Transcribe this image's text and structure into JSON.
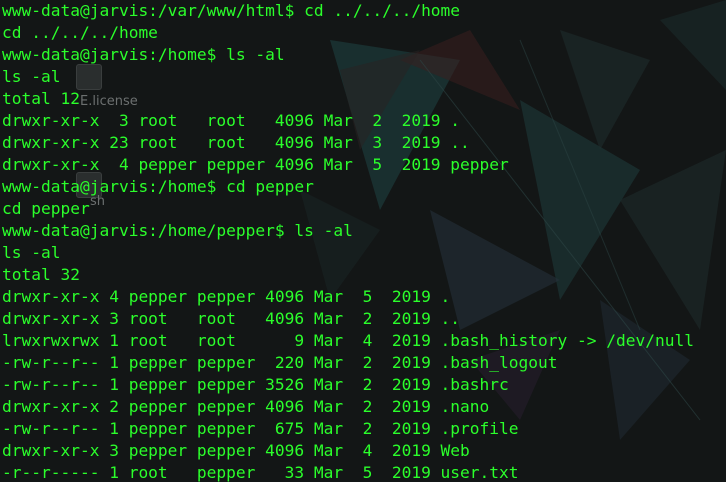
{
  "terminal": {
    "lines": [
      "www-data@jarvis:/var/www/html$ cd ../../../home",
      "cd ../../../home",
      "www-data@jarvis:/home$ ls -al",
      "ls -al",
      "total 12",
      "drwxr-xr-x  3 root   root   4096 Mar  2  2019 .",
      "drwxr-xr-x 23 root   root   4096 Mar  3  2019 ..",
      "drwxr-xr-x  4 pepper pepper 4096 Mar  5  2019 pepper",
      "www-data@jarvis:/home$ cd pepper",
      "cd pepper",
      "www-data@jarvis:/home/pepper$ ls -al",
      "ls -al",
      "total 32",
      "drwxr-xr-x 4 pepper pepper 4096 Mar  5  2019 .",
      "drwxr-xr-x 3 root   root   4096 Mar  2  2019 ..",
      "lrwxrwxrwx 1 root   root      9 Mar  4  2019 .bash_history -> /dev/null",
      "-rw-r--r-- 1 pepper pepper  220 Mar  2  2019 .bash_logout",
      "-rw-r--r-- 1 pepper pepper 3526 Mar  2  2019 .bashrc",
      "drwxr-xr-x 2 pepper pepper 4096 Mar  2  2019 .nano",
      "-rw-r--r-- 1 pepper pepper  675 Mar  2  2019 .profile",
      "drwxr-xr-x 3 pepper pepper 4096 Mar  4  2019 Web",
      "-r--r----- 1 root   pepper   33 Mar  5  2019 user.txt"
    ]
  },
  "desktop": {
    "icon_license_label": "E.license",
    "icon_second_label": "sh"
  },
  "colors": {
    "terminal_text": "#2bff2b",
    "background": "#131616"
  }
}
